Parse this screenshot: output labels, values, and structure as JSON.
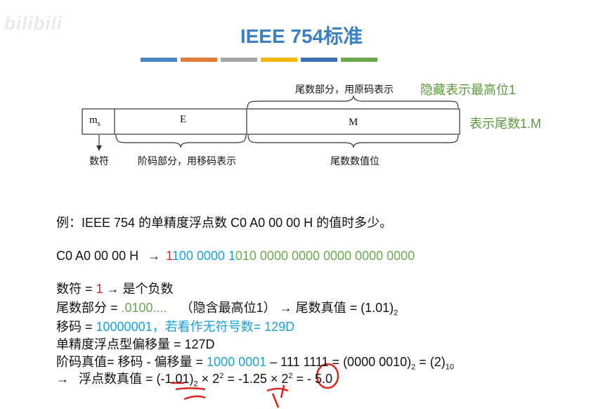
{
  "watermark": "bilibili",
  "title": "IEEE 754标准",
  "accent_colors": [
    "#4a86c8",
    "#e07b39",
    "#a5a5a5",
    "#f2b705",
    "#3e6fb5",
    "#6aa84f"
  ],
  "diagram": {
    "ms_label": "m",
    "ms_sub": "s",
    "e_label": "E",
    "m_label": "M",
    "top_brace_label": "尾数部分，用原码表示",
    "hidden_bit_note": "隐藏表示最高位1",
    "represent_note": "表示尾数1.M",
    "sign_label": "数符",
    "exponent_label": "阶码部分，用移码表示",
    "mantissa_label": "尾数数值位"
  },
  "example": {
    "question": "例：IEEE 754 的单精度浮点数 C0 A0 00 00 H 的值时多少。",
    "hex_prefix": "C0 A0 00 00 H",
    "arrow": "→",
    "bin_sign": "1",
    "bin_exponent": "100 0000 1",
    "bin_mantissa": "010 0000 0000 0000 0000 0000",
    "sign_line_label": "数符 = ",
    "sign_value": "1",
    "sign_result": "→ 是个负数",
    "mant_label": "尾数部分 = ",
    "mant_value": ".0100....",
    "mant_note": "（隐含最高位1）",
    "mant_result": "→ 尾数真值 = (1.01)",
    "mant_base": "2",
    "shift_label": "移码 = ",
    "shift_value": "10000001，若看作无符号数= 129D",
    "bias_line": "单精度浮点型偏移量 = 127D",
    "true_exp_label": "阶码真值= 移码 - 偏移量 = ",
    "true_exp_value": "1000 0001",
    "true_exp_rest": "– 111 1111 = (0000 0010)",
    "true_exp_base": "2",
    "true_exp_eq": " = (2)",
    "true_exp_base10": "10",
    "final_arrow": "→",
    "final_label": "浮点数真值 = (-1.01)",
    "final_base": "2",
    "final_times1": " × 2",
    "final_exp1": "2",
    "final_mid": " = -1.25 × 2",
    "final_exp2": "2",
    "final_result": " = - 5.0"
  }
}
